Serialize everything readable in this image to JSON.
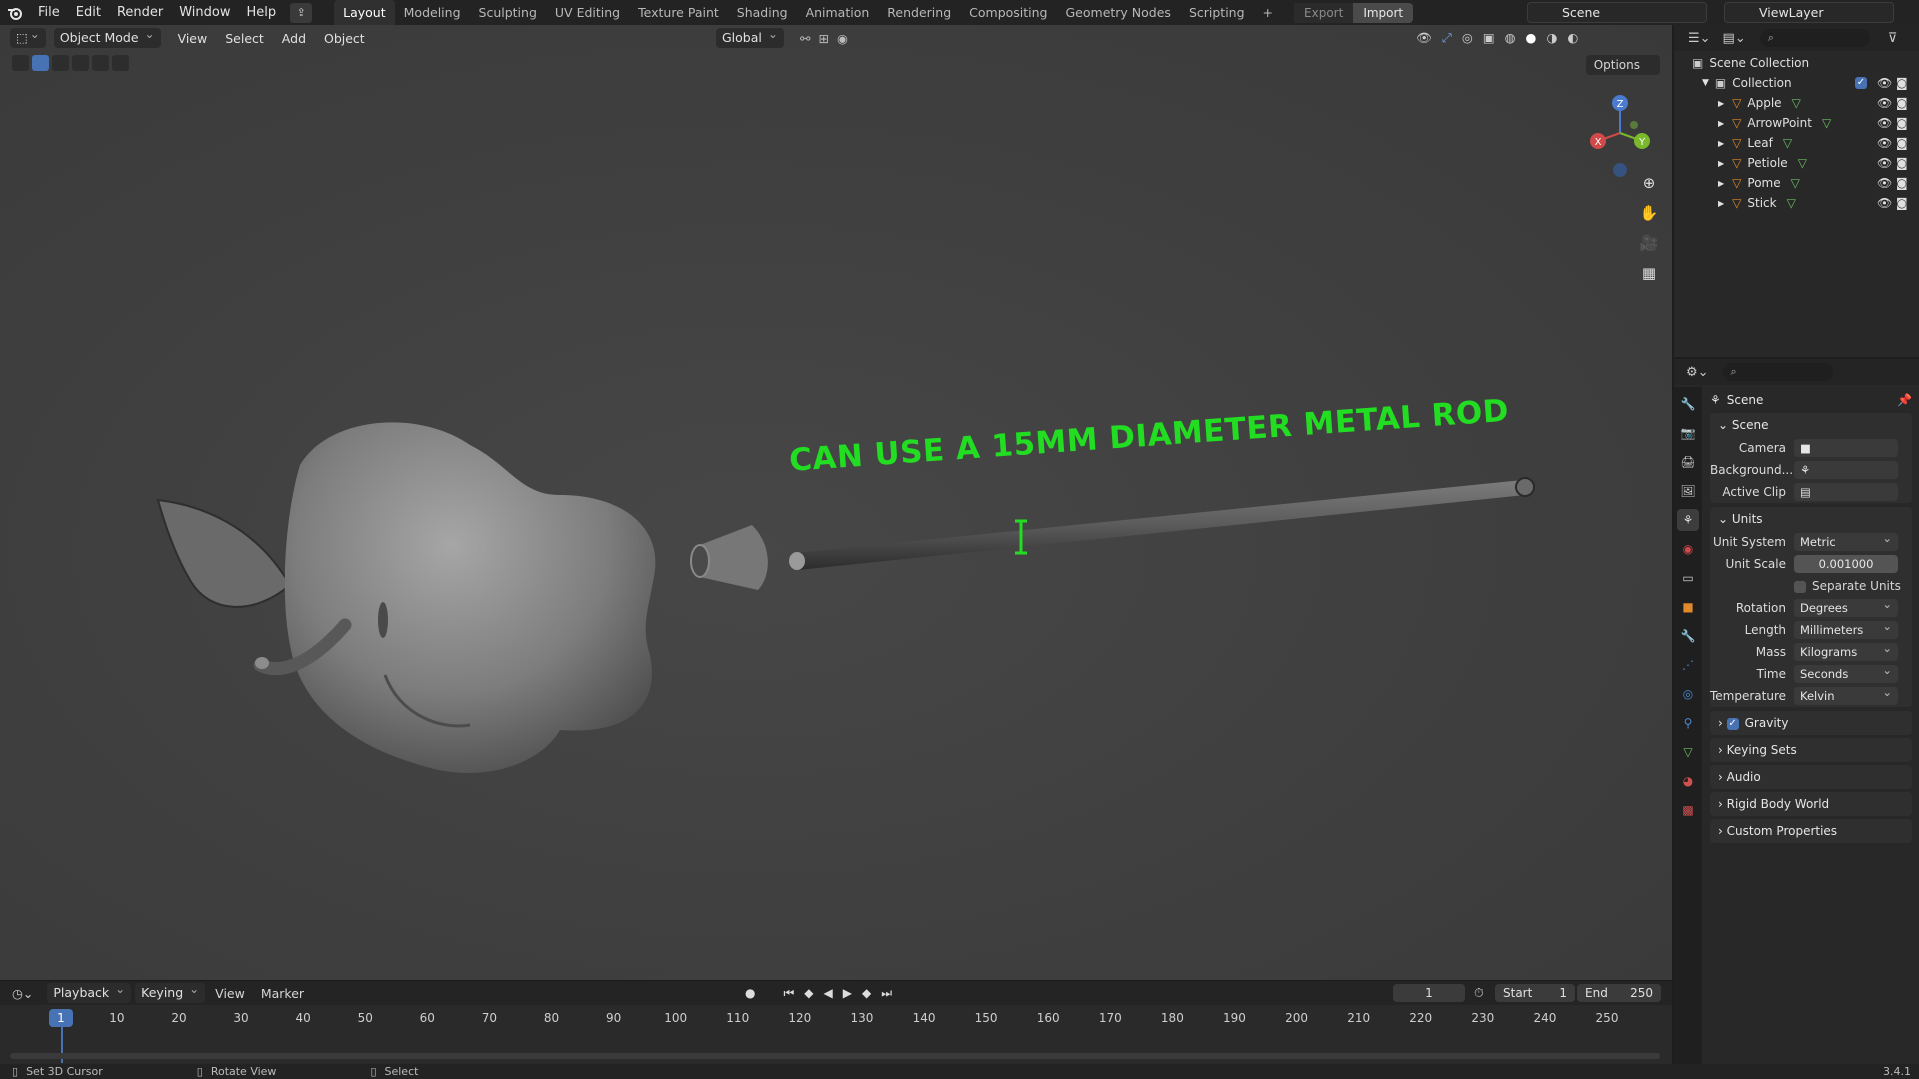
{
  "topbar": {
    "menus": [
      "File",
      "Edit",
      "Render",
      "Window",
      "Help"
    ],
    "workspaces": [
      "Layout",
      "Modeling",
      "Sculpting",
      "UV Editing",
      "Texture Paint",
      "Shading",
      "Animation",
      "Rendering",
      "Compositing",
      "Geometry Nodes",
      "Scripting"
    ],
    "active_workspace": "Layout",
    "export_label": "Export",
    "import_label": "Import",
    "scene_name": "Scene",
    "view_layer": "ViewLayer"
  },
  "viewport": {
    "mode": "Object Mode",
    "menus": [
      "View",
      "Select",
      "Add",
      "Object"
    ],
    "transform_orientation": "Global",
    "options_label": "Options",
    "annotation": "CAN USE A 15MM DIAMETER METAL ROD",
    "gizmo": {
      "x": "X",
      "y": "Y",
      "z": "Z"
    }
  },
  "outliner": {
    "root": "Scene Collection",
    "collection": "Collection",
    "objects": [
      "Apple",
      "ArrowPoint",
      "Leaf",
      "Petiole",
      "Pome",
      "Stick"
    ]
  },
  "properties": {
    "context": "Scene",
    "scene_section": "Scene",
    "camera_label": "Camera",
    "background_label": "Background...",
    "active_clip_label": "Active Clip",
    "units_section": "Units",
    "unit_system": {
      "label": "Unit System",
      "value": "Metric"
    },
    "unit_scale": {
      "label": "Unit Scale",
      "value": "0.001000"
    },
    "separate_units": "Separate Units",
    "rotation": {
      "label": "Rotation",
      "value": "Degrees"
    },
    "length": {
      "label": "Length",
      "value": "Millimeters"
    },
    "mass": {
      "label": "Mass",
      "value": "Kilograms"
    },
    "time": {
      "label": "Time",
      "value": "Seconds"
    },
    "temperature": {
      "label": "Temperature",
      "value": "Kelvin"
    },
    "collapsed_sections": [
      "Gravity",
      "Keying Sets",
      "Audio",
      "Rigid Body World",
      "Custom Properties"
    ]
  },
  "timeline": {
    "menus": [
      "Playback",
      "Keying",
      "View",
      "Marker"
    ],
    "current_frame": "1",
    "start_label": "Start",
    "start": "1",
    "end_label": "End",
    "end": "250",
    "ticks": [
      "10",
      "20",
      "30",
      "40",
      "50",
      "60",
      "70",
      "80",
      "90",
      "100",
      "110",
      "120",
      "130",
      "140",
      "150",
      "160",
      "170",
      "180",
      "190",
      "200",
      "210",
      "220",
      "230",
      "240",
      "250"
    ]
  },
  "status": {
    "hint1": "Set 3D Cursor",
    "hint2": "Rotate View",
    "hint3": "Select",
    "version": "3.4.1"
  },
  "colors": {
    "accent": "#4772b3",
    "annotation": "#22dd22"
  }
}
